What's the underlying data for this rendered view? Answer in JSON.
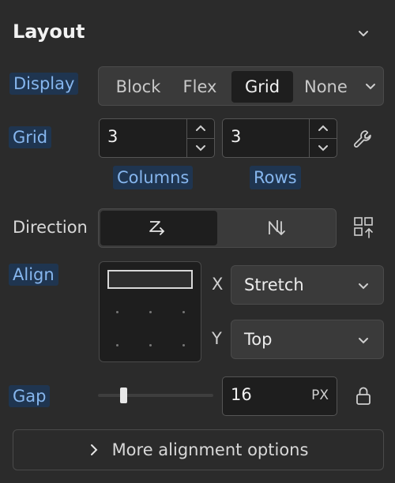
{
  "panel": {
    "title": "Layout"
  },
  "display": {
    "label": "Display",
    "options": [
      "Block",
      "Flex",
      "Grid",
      "None"
    ],
    "selected": "Grid"
  },
  "grid": {
    "label": "Grid",
    "columns_value": "3",
    "rows_value": "3",
    "columns_label": "Columns",
    "rows_label": "Rows"
  },
  "direction": {
    "label": "Direction"
  },
  "align": {
    "label": "Align",
    "x_axis": "X",
    "x_value": "Stretch",
    "y_axis": "Y",
    "y_value": "Top"
  },
  "gap": {
    "label": "Gap",
    "value": "16",
    "unit": "PX"
  },
  "more": {
    "label": "More alignment options"
  },
  "colors": {
    "background": "#2b2b2b",
    "field": "#1e1e1e",
    "highlight_bg": "#1f3550",
    "highlight_text": "#86b6ee"
  }
}
